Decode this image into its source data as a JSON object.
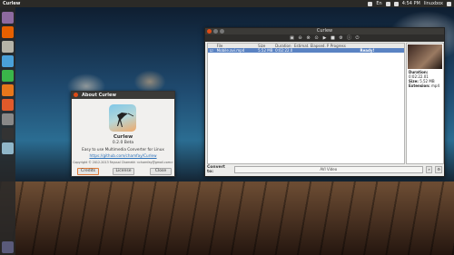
{
  "topbar": {
    "app_title": "Curlew",
    "keyboard": "En",
    "clock": "4:54 PM",
    "user": "linuxbox"
  },
  "launcher": {
    "items": [
      {
        "name": "dash",
        "color": "#8d6a9f"
      },
      {
        "name": "firefox",
        "color": "#e66000"
      },
      {
        "name": "files",
        "color": "#b5b3a8"
      },
      {
        "name": "libreoffice-writer",
        "color": "#4aa0d9"
      },
      {
        "name": "libreoffice-calc",
        "color": "#3ab54a"
      },
      {
        "name": "libreoffice-impress",
        "color": "#e7771b"
      },
      {
        "name": "software-center",
        "color": "#e05a2a"
      },
      {
        "name": "settings",
        "color": "#888"
      },
      {
        "name": "terminal",
        "color": "#333"
      },
      {
        "name": "curlew",
        "color": "#8fb6c9"
      },
      {
        "name": "trash",
        "color": "#5a5a7a"
      }
    ]
  },
  "about": {
    "window_title": "About Curlew",
    "app_name": "Curlew",
    "version": "0.2.0 Beta",
    "description": "Easy to use Multimedia Converter for Linux",
    "url": "https://github.com/chamfay/Curlew",
    "copyright": "Copyright © 2012-2013 Fayssal Chamekh <chamfay@gmail.com>",
    "buttons": {
      "credits": "Credits",
      "license": "License",
      "close": "Close"
    }
  },
  "curlew": {
    "window_title": "Curlew",
    "columns": [
      "",
      "File",
      "Size",
      "Duration",
      "Estimat. Elapsed. Remaining Time",
      "Progress"
    ],
    "rows": [
      {
        "file": "Mobile.avi.mp4",
        "size": "5.52 MB",
        "duration": "0:02:22.01",
        "time": "",
        "progress": "Ready!"
      }
    ],
    "preview": {
      "duration_label": "Duration:",
      "duration": "0:02:22.01",
      "size_label": "Size:",
      "size": "5.52 MB",
      "ext_label": "Extension:",
      "ext": "mp4"
    },
    "convert_label": "Convert to:",
    "format": "AVI Video"
  },
  "colors": {
    "accent": "#5a83c3",
    "panel": "#2b2a27",
    "close": "#df4b16"
  }
}
